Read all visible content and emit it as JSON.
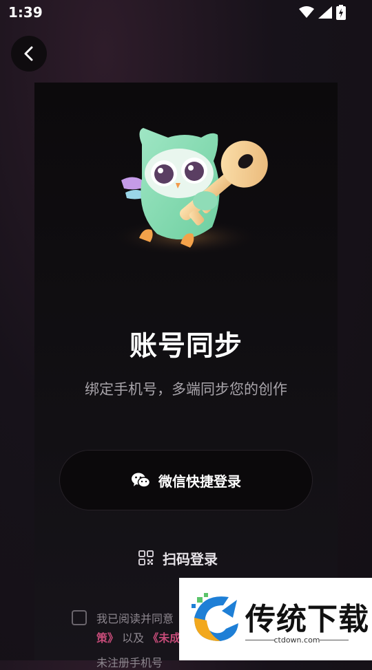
{
  "status_bar": {
    "time": "1:39"
  },
  "screen": {
    "title": "账号同步",
    "subtitle": "绑定手机号，多端同步您的创作",
    "wechat_login_label": "微信快捷登录",
    "scan_login_label": "扫码登录",
    "agreement": {
      "line1": "我已阅读并同意",
      "policy_fragment": "策》",
      "and_text": " 以及 ",
      "minor_fragment": "《未成",
      "line3": "未注册手机号"
    }
  },
  "watermark": {
    "brand": "传统下载",
    "url": "ctdown.com"
  },
  "colors": {
    "accent": "#c44b78",
    "background": "#141015"
  }
}
